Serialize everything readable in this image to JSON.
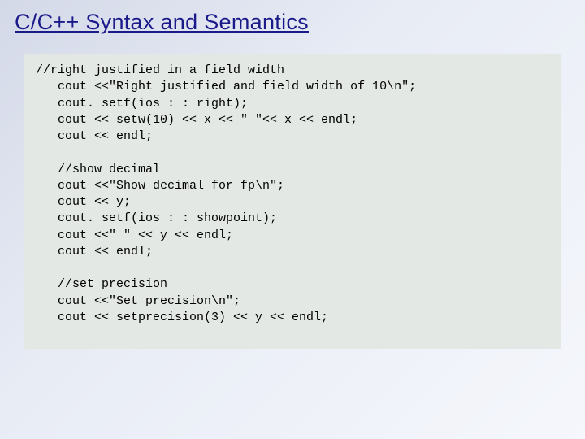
{
  "title": "C/C++ Syntax and Semantics",
  "code": {
    "l01": "//right justified in a field width",
    "l02": "   cout <<\"Right justified and field width of 10\\n\";",
    "l03": "   cout. setf(ios : : right);",
    "l04": "   cout << setw(10) << x << \" \"<< x << endl;",
    "l05": "   cout << endl;",
    "l06": "",
    "l07": "   //show decimal",
    "l08": "   cout <<\"Show decimal for fp\\n\";",
    "l09": "   cout << y;",
    "l10": "   cout. setf(ios : : showpoint);",
    "l11": "   cout <<\" \" << y << endl;",
    "l12": "   cout << endl;",
    "l13": "",
    "l14": "   //set precision",
    "l15": "   cout <<\"Set precision\\n\";",
    "l16": "   cout << setprecision(3) << y << endl;"
  }
}
